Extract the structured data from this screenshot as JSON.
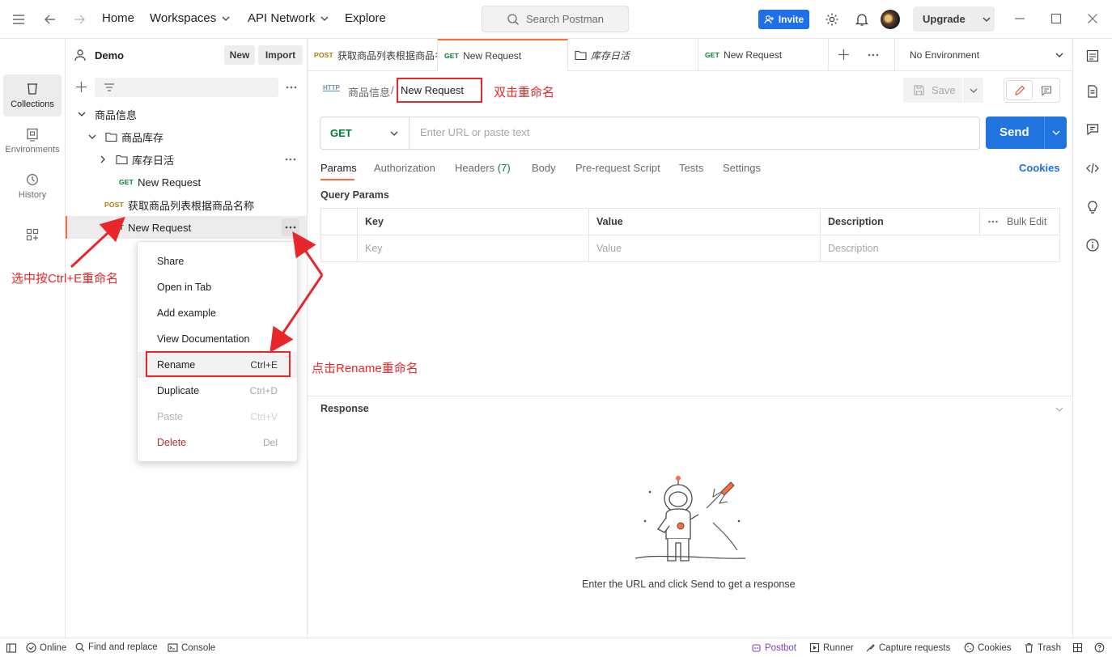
{
  "topbar": {
    "nav": [
      "Home",
      "Workspaces",
      "API Network",
      "Explore"
    ],
    "search_placeholder": "Search Postman",
    "invite_label": "Invite",
    "upgrade_label": "Upgrade"
  },
  "workspace": {
    "name": "Demo",
    "new_label": "New",
    "import_label": "Import"
  },
  "rail": [
    {
      "label": "Collections",
      "icon": "collections-icon"
    },
    {
      "label": "Environments",
      "icon": "environments-icon"
    },
    {
      "label": "History",
      "icon": "history-icon"
    }
  ],
  "tree": {
    "collection": "商品信息",
    "folder1": "商品库存",
    "folder2": "库存日活",
    "req1": {
      "method": "GET",
      "name": "New Request"
    },
    "req2": {
      "method": "POST",
      "name": "获取商品列表根据商品名称"
    },
    "req3": {
      "method": "GET",
      "name": "New Request"
    }
  },
  "context_menu": [
    {
      "label": "Share",
      "shortcut": ""
    },
    {
      "label": "Open in Tab",
      "shortcut": ""
    },
    {
      "label": "Add example",
      "shortcut": ""
    },
    {
      "label": "View Documentation",
      "shortcut": ""
    },
    {
      "label": "Rename",
      "shortcut": "Ctrl+E"
    },
    {
      "label": "Duplicate",
      "shortcut": "Ctrl+D"
    },
    {
      "label": "Paste",
      "shortcut": "Ctrl+V"
    },
    {
      "label": "Delete",
      "shortcut": "Del"
    }
  ],
  "tabs": [
    {
      "method": "POST",
      "name": "获取商品列表根据商品名称"
    },
    {
      "method": "GET",
      "name": "New Request"
    },
    {
      "method": "",
      "name": "库存日活"
    },
    {
      "method": "GET",
      "name": "New Request"
    }
  ],
  "environment": "No Environment",
  "request": {
    "breadcrumb_parent": "商品信息",
    "breadcrumb_sep": "/",
    "name": "New Request",
    "save_label": "Save",
    "method": "GET",
    "url_placeholder": "Enter URL or paste text",
    "send_label": "Send",
    "tabs": [
      "Params",
      "Authorization",
      "Headers",
      "Body",
      "Pre-request Script",
      "Tests",
      "Settings"
    ],
    "headers_count": "(7)",
    "cookies_label": "Cookies",
    "query_params_label": "Query Params",
    "columns": [
      "Key",
      "Value",
      "Description"
    ],
    "bulk_edit": "Bulk Edit",
    "placeholders": [
      "Key",
      "Value",
      "Description"
    ]
  },
  "response": {
    "title": "Response",
    "empty_text": "Enter the URL and click Send to get a response"
  },
  "annotations": {
    "double_click": "双击重命名",
    "ctrl_e": "选中按Ctrl+E重命名",
    "click_rename": "点击Rename重命名"
  },
  "statusbar": {
    "online": "Online",
    "find_replace": "Find and replace",
    "console": "Console",
    "postbot": "Postbot",
    "runner": "Runner",
    "capture": "Capture requests",
    "cookies": "Cookies",
    "trash": "Trash"
  },
  "colors": {
    "accent": "#ff6c37",
    "send": "#1f74e0",
    "get": "#007f31",
    "post": "#ad7a03",
    "annotation": "#e8272a"
  }
}
